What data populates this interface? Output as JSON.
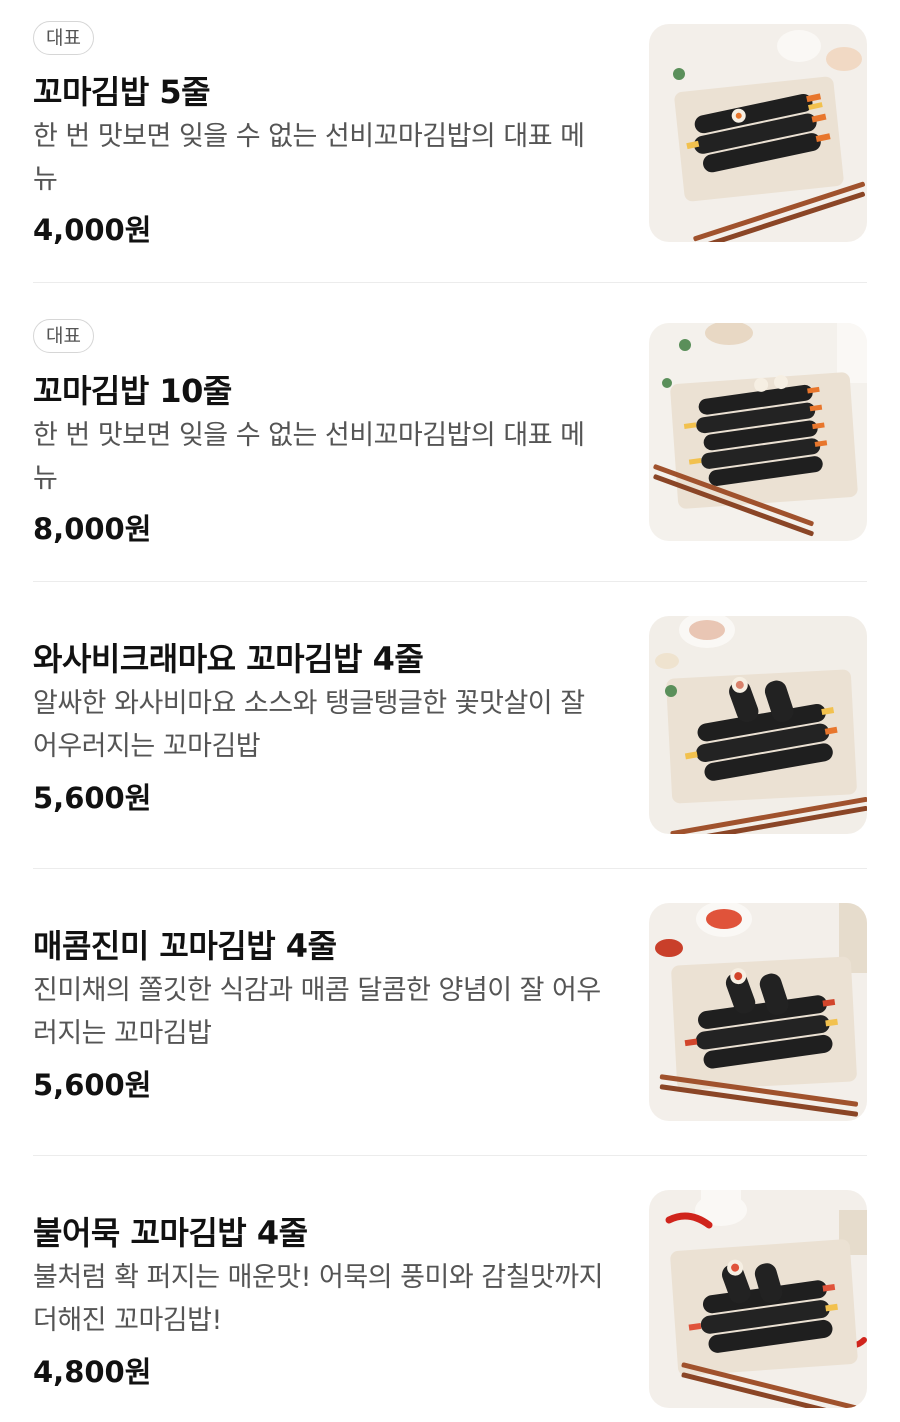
{
  "menu": {
    "items": [
      {
        "badge": "대표",
        "name": "꼬마김밥 5줄",
        "description": "한 번 맛보면 잊을 수 없는 선비꼬마김밥의 대표 메뉴",
        "price": "4,000원",
        "image_icon": "kimbap-photo-icon"
      },
      {
        "badge": "대표",
        "name": "꼬마김밥 10줄",
        "description": "한 번 맛보면 잊을 수 없는 선비꼬마김밥의 대표 메뉴",
        "price": "8,000원",
        "image_icon": "kimbap-photo-icon"
      },
      {
        "name": "와사비크래마요 꼬마김밥 4줄",
        "description": "알싸한 와사비마요 소스와 탱글탱글한 꽃맛살이 잘 어우러지는 꼬마김밥",
        "price": "5,600원",
        "image_icon": "kimbap-photo-icon"
      },
      {
        "name": "매콤진미 꼬마김밥 4줄",
        "description": "진미채의 쫄깃한 식감과 매콤 달콤한 양념이 잘 어우러지는 꼬마김밥",
        "price": "5,600원",
        "image_icon": "kimbap-photo-icon"
      },
      {
        "name": "불어묵 꼬마김밥 4줄",
        "description": "불처럼 확 퍼지는 매운맛! 어묵의 풍미와 감칠맛까지 더해진 꼬마김밥!",
        "price": "4,800원",
        "image_icon": "kimbap-photo-icon"
      }
    ]
  },
  "colors": {
    "background": "#ffffff",
    "text_primary": "#111111",
    "text_secondary": "#555555",
    "badge_border": "#d6d6d6",
    "divider": "#ececec",
    "plate": "#efe6da",
    "seaweed": "#1f1f1f",
    "carrot": "#e8762c",
    "egg": "#f2c14e",
    "chopsticks": "#a0522d"
  }
}
